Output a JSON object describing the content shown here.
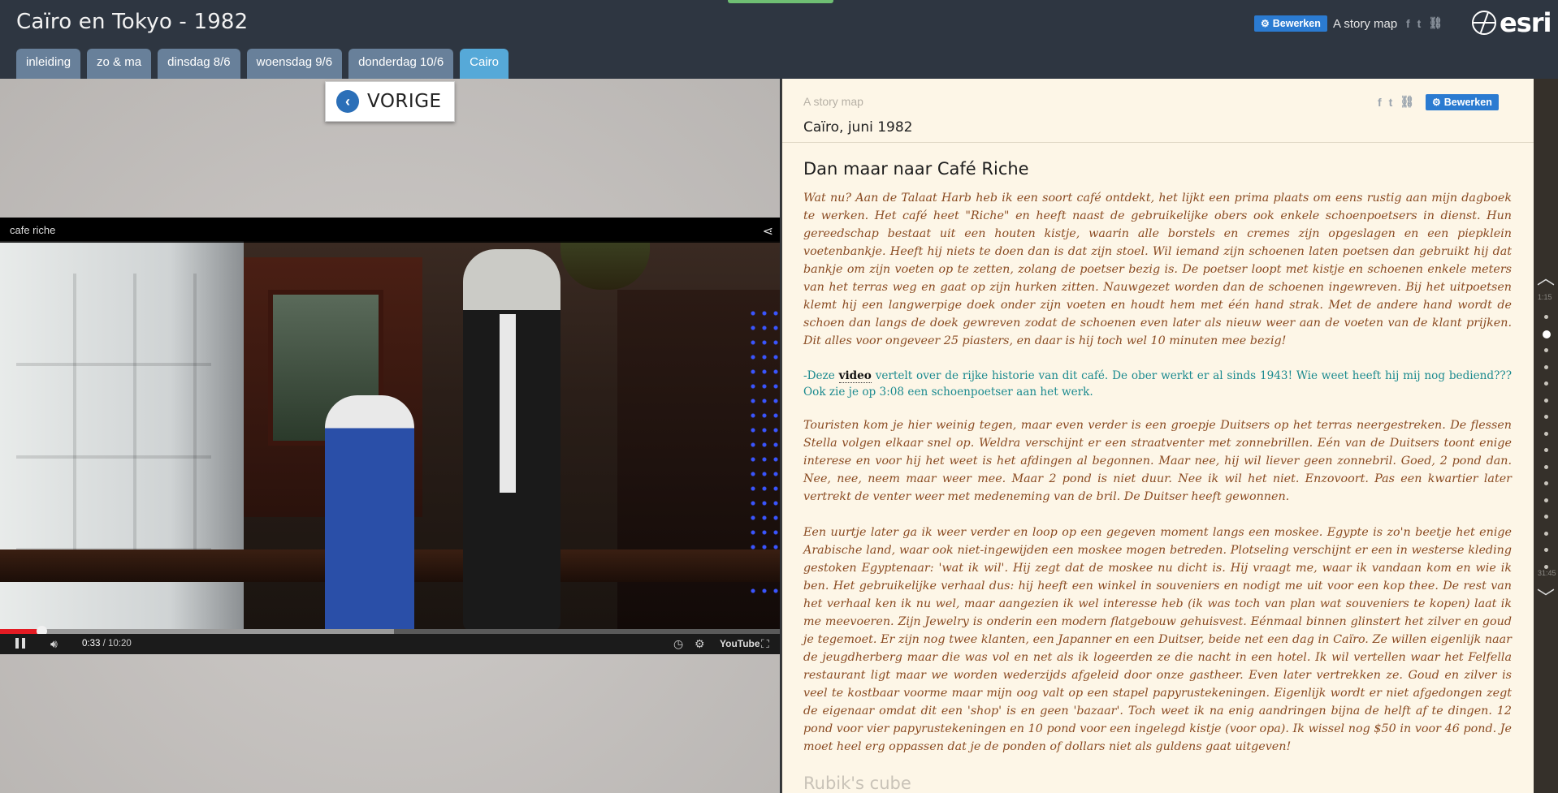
{
  "header": {
    "title": "Caïro en Tokyo - 1982",
    "edit_label": "Bewerken",
    "story_map_label": "A story map",
    "share_icons": [
      "facebook-icon",
      "twitter-icon",
      "link-icon"
    ],
    "logo_text": "esri"
  },
  "tabs": [
    {
      "label": "inleiding",
      "active": false
    },
    {
      "label": "zo & ma",
      "active": false
    },
    {
      "label": "dinsdag 8/6",
      "active": false
    },
    {
      "label": "woensdag 9/6",
      "active": false
    },
    {
      "label": "donderdag 10/6",
      "active": false
    },
    {
      "label": "Cairo",
      "active": true
    }
  ],
  "media": {
    "prev_label": "VORIGE",
    "video": {
      "title": "cafe riche",
      "current_time": "0:33",
      "duration": "10:20",
      "played_fraction": 0.053,
      "buffered_fraction": 0.505,
      "youtube_label": "YouTube"
    }
  },
  "story": {
    "subtitle": "A story map",
    "title": "Caïro, juni 1982",
    "edit_label": "Bewerken",
    "section_title": "Dan maar naar Café Riche",
    "paragraph1": "Wat nu? Aan de Talaat Harb heb ik een soort café ontdekt, het lijkt een prima plaats om eens rustig aan mijn dagboek te werken. Het café heet \"Riche\" en heeft naast de gebruikelijke obers ook enkele schoenpoetsers in dienst. Hun gereedschap bestaat uit een houten kistje, waarin alle borstels en cremes zijn opgeslagen en een piepklein voetenbankje. Heeft hij niets te doen dan is dat zijn stoel. Wil iemand zijn schoenen laten poetsen dan gebruikt hij dat bankje om zijn voeten op te zetten, zolang de poetser bezig is. De poetser loopt met kistje en schoenen enkele meters van het terras weg en gaat op zijn hurken zitten. Nauwgezet worden dan de schoenen ingewreven. Bij het uitpoetsen klemt hij een langwerpige doek onder zijn voeten en houdt hem met één hand strak. Met de andere hand wordt de schoen dan langs de doek gewreven zodat de schoenen even later als nieuw weer aan de voeten van de klant prijken. Dit alles voor ongeveer 25 piasters, en daar is hij toch wel 10 minuten mee bezig!",
    "video_note_prefix": "-Deze ",
    "video_note_link": "video",
    "video_note_suffix": " vertelt over de rijke historie van dit café. De ober werkt er al sinds 1943! Wie weet heeft hij mij nog bediend??? Ook zie je op 3:08 een schoenpoetser aan het werk.",
    "paragraph2": "Touristen kom je hier weinig tegen, maar even verder is een groepje Duitsers op het terras neergestreken. De flessen Stella volgen elkaar snel op. Weldra verschijnt er een straatventer met zonnebrillen. Eén van de Duitsers toont enige interese en voor hij het weet is het afdingen al begonnen. Maar nee, hij wil liever geen zonnebril. Goed, 2 pond dan. Nee, nee, neem maar weer mee. Maar 2 pond is niet duur. Nee ik wil het niet. Enzovoort. Pas een kwartier later vertrekt de venter weer met medeneming van de bril. De Duitser heeft gewonnen.",
    "paragraph3": "Een uurtje later ga ik weer verder en loop op een gegeven moment langs een moskee. Egypte is zo'n beetje het enige Arabische land, waar ook niet-ingewijden een moskee mogen betreden. Plotseling verschijnt er een in westerse kleding gestoken Egyptenaar: 'wat ik wil'. Hij zegt dat de moskee nu dicht is. Hij vraagt me, waar ik vandaan kom en wie ik ben. Het gebruikelijke verhaal dus: hij heeft een winkel in souveniers en nodigt me uit voor een kop thee. De rest van het verhaal ken ik nu wel, maar aangezien ik wel interesse heb (ik was toch van plan wat souveniers te kopen) laat ik me meevoeren. Zijn Jewelry is onderin een modern flatgebouw gehuisvest. Eénmaal binnen glinstert het zilver en goud je tegemoet. Er zijn nog twee klanten, een Japanner en een Duitser, beide net een dag in Caïro. Ze willen eigenlijk naar de jeugdherberg maar die was vol en net als ik logeerden ze die nacht in een hotel. Ik wil vertellen waar het Felfella restaurant ligt maar we worden wederzijds afgeleid door onze gastheer. Even later vertrekken ze. Goud en zilver is veel te kostbaar voorme maar mijn oog valt op een stapel papyrustekeningen. Eigenlijk wordt er niet afgedongen zegt de eigenaar omdat dit een 'shop' is en geen 'bazaar'. Toch weet ik na enig aandringen bijna de helft af te dingen. 12 pond voor vier papyrustekeningen en 10 pond voor een ingelegd kistje (voor opa). Ik wissel nog $50 in voor 46 pond. Je moet heel erg oppassen dat je de ponden of dollars niet als guldens gaat uitgeven!",
    "next_section_title": "Rubik's cube"
  },
  "navstrip": {
    "time_top": "1:15",
    "time_bottom": "31:45",
    "dot_count": 16,
    "active_dot": 1
  },
  "colors": {
    "header_bg": "#2e3641",
    "tab": "#68809a",
    "tab_active": "#56a9d8",
    "accent_button": "#2b7bd1",
    "story_bg": "#fdf6e7",
    "story_text": "#8a4b22",
    "note_text": "#1b8a8f",
    "progress_played": "#e31b23"
  }
}
